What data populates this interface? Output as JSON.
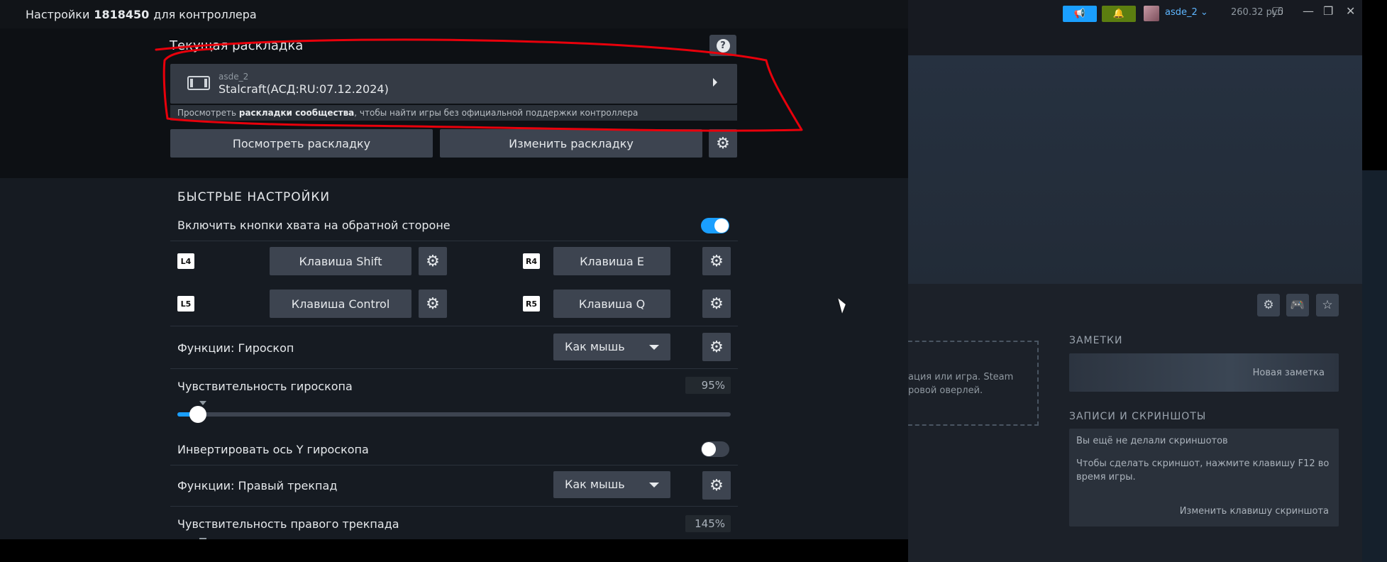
{
  "dialog": {
    "title_prefix": "Настройки",
    "title_id": "1818450",
    "title_suffix": "для контроллера"
  },
  "current_layout": {
    "heading": "Текущая раскладка",
    "author": "asde_2",
    "name": "Stalcraft(АСД:RU:07.12.2024)",
    "community_note_prefix": "Просмотреть",
    "community_note_bold": "раскладки сообщества",
    "community_note_suffix": ", чтобы найти игры без официальной поддержки контроллера",
    "view_button": "Посмотреть раскладку",
    "edit_button": "Изменить раскладку"
  },
  "quick_settings": {
    "heading": "БЫСТРЫЕ НАСТРОЙКИ",
    "grip_toggle_label": "Включить кнопки хвата на обратной стороне",
    "grip_toggle_on": true,
    "bindings": [
      {
        "key": "L4",
        "action": "Клавиша Shift"
      },
      {
        "key": "R4",
        "action": "Клавиша E"
      },
      {
        "key": "L5",
        "action": "Клавиша Control"
      },
      {
        "key": "R5",
        "action": "Клавиша Q"
      }
    ],
    "gyro_function_label": "Функции: Гироскоп",
    "gyro_function_value": "Как мышь",
    "gyro_sensitivity_label": "Чувствительность гироскопа",
    "gyro_sensitivity_value": "95%",
    "gyro_sensitivity_fraction": 0.037,
    "invert_gyro_label": "Инвертировать ось Y гироскопа",
    "invert_gyro_on": false,
    "right_trackpad_label": "Функции: Правый трекпад",
    "right_trackpad_value": "Как мышь",
    "right_trackpad_sensitivity_label": "Чувствительность правого трекпада",
    "right_trackpad_sensitivity_value": "145%"
  },
  "steam_window": {
    "username": "asde_2",
    "balance": "260.32 руб",
    "dashed_text": "ация или игра. Steam ровой оверлей.",
    "notes_heading": "ЗАМЕТКИ",
    "new_note": "Новая заметка",
    "screenshots_heading": "ЗАПИСИ И СКРИНШОТЫ",
    "screenshots_empty": "Вы ещё не делали скриншотов",
    "screenshots_hint": "Чтобы сделать скриншот, нажмите клавишу F12 во время игры.",
    "screenshots_change_key": "Изменить клавишу скриншота"
  },
  "colors": {
    "accent_blue": "#1a9fff",
    "notify_green": "#5c7e10",
    "annotation_red": "#e8000b",
    "button_bg": "#3d4450"
  },
  "icons": [
    "help-icon",
    "controller-icon",
    "chevron-right-icon",
    "gear-icon",
    "caret-down-icon",
    "megaphone-icon",
    "bell-icon",
    "monitor-icon",
    "minimize-icon",
    "maximize-icon",
    "close-icon",
    "gamepad-icon",
    "star-icon"
  ]
}
